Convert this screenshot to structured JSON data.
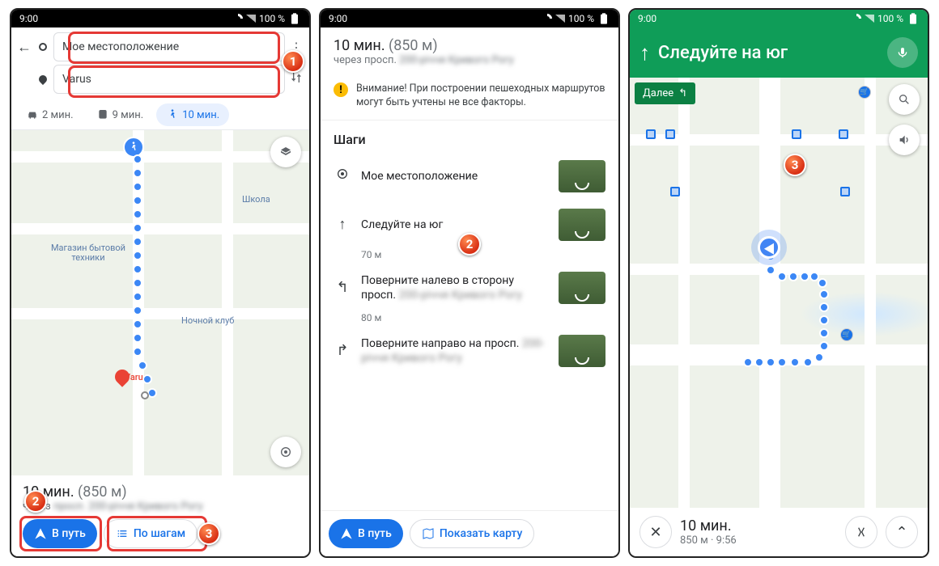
{
  "status": {
    "time": "9:00",
    "battery": "100 %"
  },
  "badges": {
    "b1": "1",
    "b2": "2",
    "b3": "3"
  },
  "phone1": {
    "from": "Мое местоположение",
    "to": "Varus",
    "modes": {
      "car": "2 мин.",
      "bus": "9 мин.",
      "walk": "10 мин."
    },
    "map": {
      "poi_store": "Магазин бытовой техники",
      "poi_school": "Школа",
      "poi_club": "Ночной клуб",
      "dest": "Varus"
    },
    "sheet": {
      "time": "10 мин.",
      "dist": "(850 м)",
      "via_prefix": "через",
      "via_blur": "просп. 200-річчя Кривого Рогу"
    },
    "btn_go": "В путь",
    "btn_steps": "По шагам"
  },
  "phone2": {
    "head": {
      "time": "10 мин.",
      "dist": "(850 м)",
      "via_prefix": "через просп.",
      "via_blur": "200-річчя Кривого Рогу"
    },
    "warn": "Внимание! При построении пешеходных маршрутов могут быть учтены не все факторы.",
    "steps_title": "Шаги",
    "steps": [
      {
        "icon": "loc",
        "text": "Мое местоположение"
      },
      {
        "icon": "up",
        "text": "Следуйте на юг",
        "dist": "70 м"
      },
      {
        "icon": "left",
        "text": "Поверните налево в сторону просп.",
        "blur": "200-річчя Кривого Рогу",
        "dist": "80 м"
      },
      {
        "icon": "right",
        "text": "Поверните направо на просп.",
        "blur": "200-річчя Кривого Рогу"
      }
    ],
    "btn_go": "В путь",
    "btn_map": "Показать карту"
  },
  "phone3": {
    "instruction": "Следуйте на юг",
    "next": "Далее",
    "sheet": {
      "time": "10 мин.",
      "dist": "850 м",
      "eta": "9:56"
    }
  }
}
